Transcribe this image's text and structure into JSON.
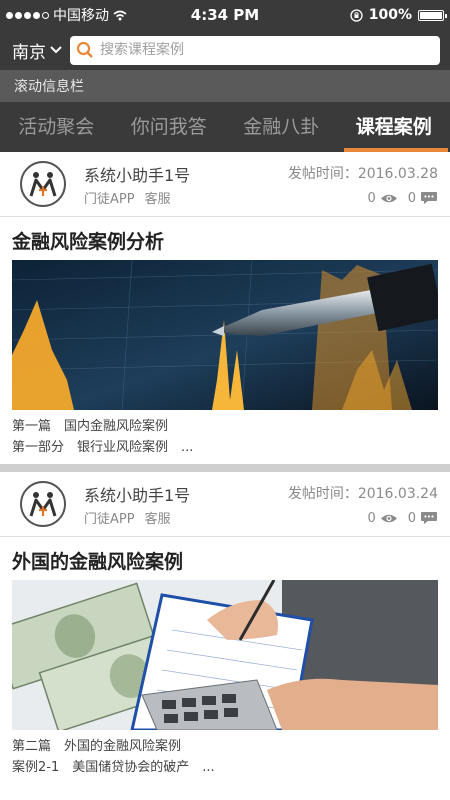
{
  "status": {
    "carrier": "中国移动",
    "time": "4:34 PM",
    "battery": "100%"
  },
  "search": {
    "city": "南京",
    "placeholder": "搜索课程案例"
  },
  "ticker": {
    "text": "滚动信息栏"
  },
  "tabs": [
    {
      "label": "活动聚会"
    },
    {
      "label": "你问我答"
    },
    {
      "label": "金融八卦"
    },
    {
      "label": "课程案例"
    }
  ],
  "posts": [
    {
      "author": "系统小助手1号",
      "tags": [
        "门徒APP",
        "客服"
      ],
      "time": "发帖时间：2016.03.28",
      "views": "0",
      "comments": "0",
      "title": "金融风险案例分析",
      "lines": [
        "第一篇　国内金融风险案例",
        "第一部分　银行业风险案例　..."
      ]
    },
    {
      "author": "系统小助手1号",
      "tags": [
        "门徒APP",
        "客服"
      ],
      "time": "发帖时间：2016.03.24",
      "views": "0",
      "comments": "0",
      "title": "外国的金融风险案例",
      "lines": [
        "第二篇　外国的金融风险案例",
        "案例2-1　美国储贷协会的破产　..."
      ]
    }
  ],
  "colors": {
    "header_bg": "#3a3a3a",
    "ticker_bg": "#5a5a5a",
    "accent": "#e8883a"
  }
}
